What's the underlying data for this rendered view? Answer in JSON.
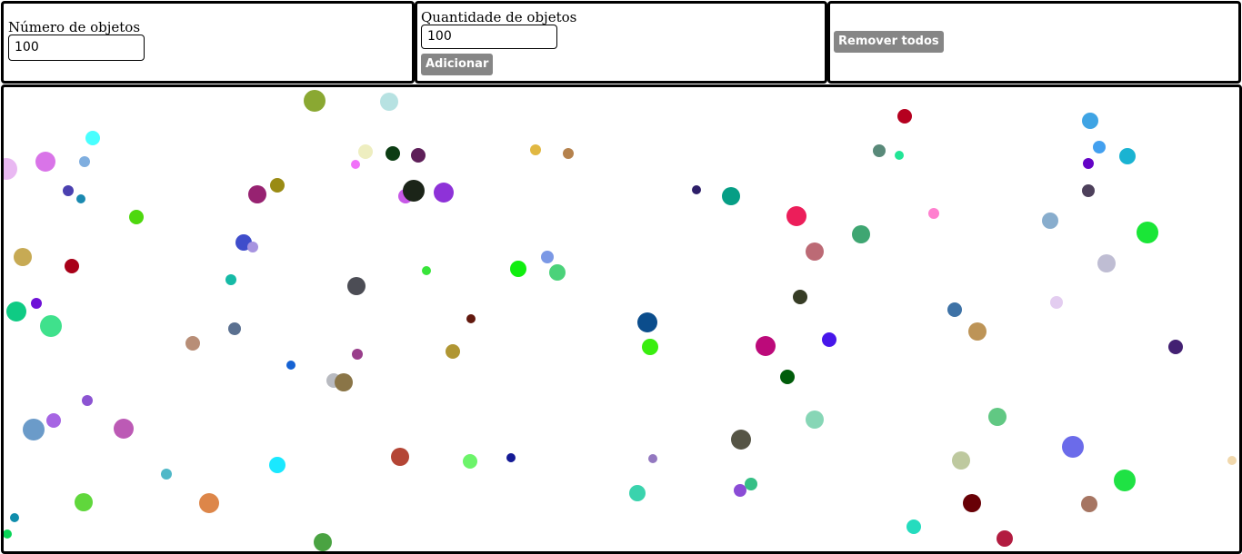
{
  "panel_numero": {
    "label": "Número de objetos",
    "value": "100"
  },
  "panel_quantidade": {
    "label": "Quantidade de objetos",
    "value": "100",
    "add_label": "Adicionar"
  },
  "panel_remover": {
    "remove_label": "Remover todos"
  },
  "button_color": "#868686",
  "objects": [
    [
      "#8aa832",
      12
    ],
    [
      "#b7e2e2",
      10
    ],
    [
      "#b5001f",
      8
    ],
    [
      "#3fa4e4",
      9
    ],
    [
      "#49ffff",
      8
    ],
    [
      "#d974e8",
      11
    ],
    [
      "#7faedf",
      6
    ],
    [
      "#e9b8f2",
      12
    ],
    [
      "#eeeec0",
      8
    ],
    [
      "#0c3d13",
      8
    ],
    [
      "#5e1f59",
      8
    ],
    [
      "#e1b842",
      6
    ],
    [
      "#b5824d",
      6
    ],
    [
      "#598979",
      7
    ],
    [
      "#22e596",
      5
    ],
    [
      "#43a0ef",
      7
    ],
    [
      "#1ab3d2",
      9
    ],
    [
      "#f172f9",
      5
    ],
    [
      "#6403c6",
      6
    ],
    [
      "#4b40b0",
      6
    ],
    [
      "#1a89b0",
      5
    ],
    [
      "#972271",
      10
    ],
    [
      "#9a8b14",
      8
    ],
    [
      "#c758e7",
      8
    ],
    [
      "#1b2418",
      12
    ],
    [
      "#8e32d8",
      11
    ],
    [
      "#2d1e69",
      5
    ],
    [
      "#069e85",
      10
    ],
    [
      "#ec1e5a",
      11
    ],
    [
      "#ff80cf",
      6
    ],
    [
      "#4d405b",
      7
    ],
    [
      "#88adcd",
      9
    ],
    [
      "#4ed80e",
      8
    ],
    [
      "#38e43a",
      5
    ],
    [
      "#3f4dcb",
      9
    ],
    [
      "#a794e0",
      6
    ],
    [
      "#3fa672",
      10
    ],
    [
      "#1ae637",
      12
    ],
    [
      "#c7aa54",
      10
    ],
    [
      "#a80018",
      8
    ],
    [
      "#bc6a75",
      10
    ],
    [
      "#bfbdd3",
      10
    ],
    [
      "#16baa6",
      6
    ],
    [
      "#4c4d55",
      10
    ],
    [
      "#10ee0f",
      9
    ],
    [
      "#7b98e5",
      7
    ],
    [
      "#4bd27a",
      9
    ],
    [
      "#62190e",
      5
    ],
    [
      "#363c25",
      8
    ],
    [
      "#0fcb84",
      11
    ],
    [
      "#6e11d7",
      6
    ],
    [
      "#3fe18c",
      12
    ],
    [
      "#3e72a6",
      8
    ],
    [
      "#e3cdf0",
      7
    ],
    [
      "#5a7090",
      7
    ],
    [
      "#b88e77",
      8
    ],
    [
      "#0b4d8c",
      11
    ],
    [
      "#39ee0f",
      9
    ],
    [
      "#bc0a7a",
      11
    ],
    [
      "#4716ea",
      8
    ],
    [
      "#bd9457",
      10
    ],
    [
      "#432072",
      8
    ],
    [
      "#993e8b",
      6
    ],
    [
      "#1562d3",
      5
    ],
    [
      "#b09633",
      8
    ],
    [
      "#b8bac0",
      8
    ],
    [
      "#8a7547",
      10
    ],
    [
      "#005c0a",
      8
    ],
    [
      "#8c54d2",
      6
    ],
    [
      "#a665e3",
      8
    ],
    [
      "#bc5ab5",
      11
    ],
    [
      "#6b9bc9",
      12
    ],
    [
      "#87d6b6",
      10
    ],
    [
      "#61c883",
      10
    ],
    [
      "#565546",
      11
    ],
    [
      "#50b8c8",
      6
    ],
    [
      "#1ae8ff",
      9
    ],
    [
      "#b44535",
      10
    ],
    [
      "#6cf46a",
      8
    ],
    [
      "#141a95",
      5
    ],
    [
      "#9378c0",
      5
    ],
    [
      "#bec99f",
      10
    ],
    [
      "#6b6bea",
      12
    ],
    [
      "#1fe244",
      12
    ],
    [
      "#f1d8ac",
      5
    ],
    [
      "#60d73c",
      10
    ],
    [
      "#dd8649",
      11
    ],
    [
      "#3ad3ad",
      9
    ],
    [
      "#8b4cd6",
      7
    ],
    [
      "#36bf86",
      7
    ],
    [
      "#680006",
      10
    ],
    [
      "#a67562",
      9
    ],
    [
      "#108dac",
      5
    ],
    [
      "#09d557",
      5
    ],
    [
      "#4aa342",
      10
    ],
    [
      "#25dcbe",
      8
    ],
    [
      "#b21c40",
      9
    ]
  ]
}
